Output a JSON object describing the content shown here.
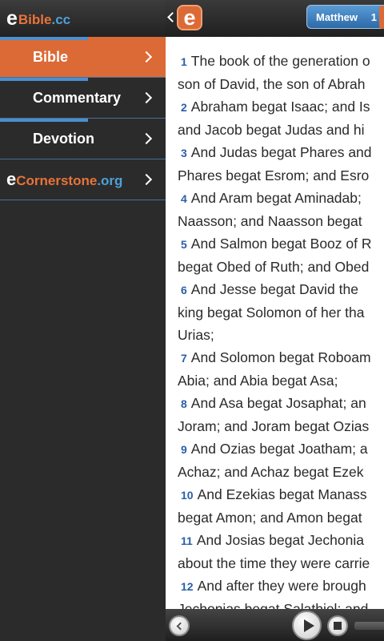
{
  "logo": {
    "e": "e",
    "word": "Bible",
    "tld": ".cc"
  },
  "sidebar": {
    "items": [
      {
        "label": "Bible",
        "active": true
      },
      {
        "label": "Commentary",
        "active": false
      },
      {
        "label": "Devotion",
        "active": false
      }
    ],
    "link": {
      "e": "e",
      "word": "Cornerstone",
      "tld": ".org"
    }
  },
  "topbar": {
    "app_icon": "e",
    "book": "Matthew",
    "chapter": "1"
  },
  "verses": [
    {
      "n": "1",
      "l1": "The book of the generation o",
      "l2": "son of David, the son of Abrah"
    },
    {
      "n": "2",
      "l1": "Abraham begat Isaac; and Is",
      "l2": "and Jacob begat Judas and hi"
    },
    {
      "n": "3",
      "l1": "And Judas begat Phares and",
      "l2": "Phares begat Esrom; and Esro"
    },
    {
      "n": "4",
      "l1": "And Aram begat Aminadab;",
      "l2": "Naasson; and Naasson begat"
    },
    {
      "n": "5",
      "l1": "And Salmon begat Booz of R",
      "l2": "begat Obed of Ruth; and Obed"
    },
    {
      "n": "6",
      "l1": "And Jesse begat David the",
      "l2": "king begat Solomon of her tha",
      "l3": "Urias;"
    },
    {
      "n": "7",
      "l1": "And Solomon begat Roboam",
      "l2": "Abia; and Abia begat Asa;"
    },
    {
      "n": "8",
      "l1": "And Asa begat Josaphat; an",
      "l2": "Joram; and Joram begat Ozias"
    },
    {
      "n": "9",
      "l1": "And Ozias begat Joatham; a",
      "l2": "Achaz; and Achaz begat Ezek"
    },
    {
      "n": "10",
      "l1": "And Ezekias begat Manass",
      "l2": "begat Amon; and Amon begat"
    },
    {
      "n": "11",
      "l1": "And Josias begat Jechonia",
      "l2": "about the time they were carrie"
    },
    {
      "n": "12",
      "l1": "And after they were brough",
      "l2": "Jechonias begat Salathiel; and"
    }
  ],
  "colors": {
    "accent_orange": "#dc6a36",
    "accent_blue": "#4a8fd0",
    "verse_number": "#2b5fa5"
  },
  "icons": [
    "back-chevron-icon",
    "app-e-icon",
    "chevron-right-icon",
    "previous-icon",
    "play-icon",
    "stop-icon"
  ]
}
